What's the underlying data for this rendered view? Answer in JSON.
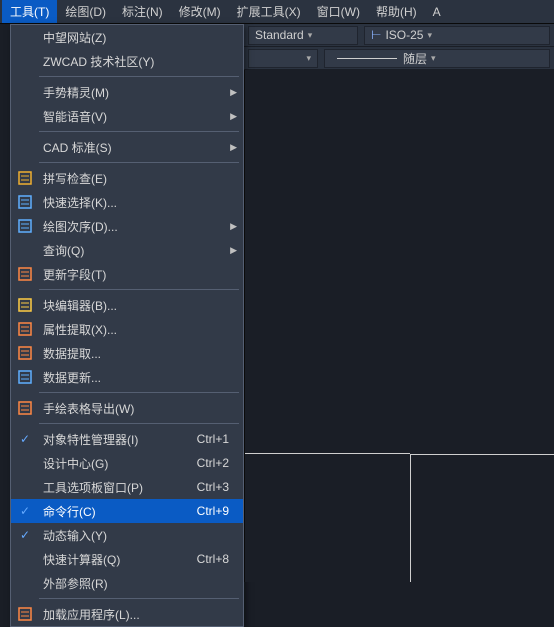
{
  "menubar": {
    "items": [
      {
        "label": "工具(T)",
        "active": true
      },
      {
        "label": "绘图(D)"
      },
      {
        "label": "标注(N)"
      },
      {
        "label": "修改(M)"
      },
      {
        "label": "扩展工具(X)"
      },
      {
        "label": "窗口(W)"
      },
      {
        "label": "帮助(H)"
      },
      {
        "label": "A"
      }
    ]
  },
  "toolbar": {
    "style": "Standard",
    "dimstyle": "ISO-25",
    "layer_by": "随层"
  },
  "menu": {
    "groups": [
      [
        {
          "label": "中望网站(Z)",
          "icon": ""
        },
        {
          "label": "ZWCAD 技术社区(Y)",
          "icon": ""
        }
      ],
      [
        {
          "label": "手势精灵(M)",
          "icon": "",
          "submenu": true
        },
        {
          "label": "智能语音(V)",
          "icon": "",
          "submenu": true
        }
      ],
      [
        {
          "label": "CAD 标准(S)",
          "icon": "",
          "submenu": true
        }
      ],
      [
        {
          "label": "拼写检查(E)",
          "icon": "spellcheck"
        },
        {
          "label": "快速选择(K)...",
          "icon": "quicksel"
        },
        {
          "label": "绘图次序(D)...",
          "icon": "draworder",
          "submenu": true
        },
        {
          "label": "查询(Q)",
          "icon": "",
          "submenu": true
        },
        {
          "label": "更新字段(T)",
          "icon": "field"
        }
      ],
      [
        {
          "label": "块编辑器(B)...",
          "icon": "blockedit"
        },
        {
          "label": "属性提取(X)...",
          "icon": "attrext"
        },
        {
          "label": "数据提取...",
          "icon": "dataext"
        },
        {
          "label": "数据更新...",
          "icon": "dataupd"
        }
      ],
      [
        {
          "label": "手绘表格导出(W)",
          "icon": "tableexp"
        }
      ],
      [
        {
          "label": "对象特性管理器(I)",
          "icon": "check",
          "accel": "Ctrl+1"
        },
        {
          "label": "设计中心(G)",
          "icon": "",
          "accel": "Ctrl+2"
        },
        {
          "label": "工具选项板窗口(P)",
          "icon": "",
          "accel": "Ctrl+3"
        },
        {
          "label": "命令行(C)",
          "icon": "check",
          "accel": "Ctrl+9",
          "highlight": true
        },
        {
          "label": "动态输入(Y)",
          "icon": "check"
        },
        {
          "label": "快速计算器(Q)",
          "icon": "",
          "accel": "Ctrl+8"
        },
        {
          "label": "外部参照(R)",
          "icon": ""
        }
      ],
      [
        {
          "label": "加载应用程序(L)...",
          "icon": "loadapp"
        }
      ]
    ]
  }
}
